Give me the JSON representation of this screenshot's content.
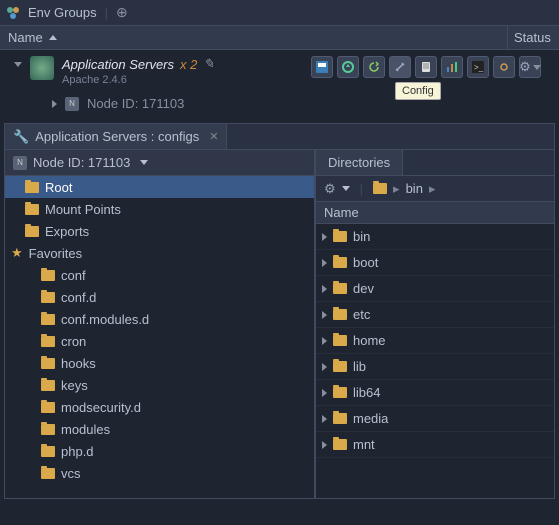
{
  "env_groups_label": "Env Groups",
  "header": {
    "name": "Name",
    "status": "Status"
  },
  "app": {
    "title": "Application Servers",
    "count": "x 2",
    "subtitle": "Apache 2.4.6",
    "node": "Node ID: 171103"
  },
  "tooltip": "Config",
  "panel_tab": "Application Servers : configs",
  "left": {
    "node_header": "Node ID: 171103",
    "root": "Root",
    "mount": "Mount Points",
    "exports": "Exports",
    "favorites": "Favorites",
    "items": [
      "conf",
      "conf.d",
      "conf.modules.d",
      "cron",
      "hooks",
      "keys",
      "modsecurity.d",
      "modules",
      "php.d",
      "vcs"
    ]
  },
  "right": {
    "tab": "Directories",
    "crumb": "bin",
    "name_header": "Name",
    "dirs": [
      "bin",
      "boot",
      "dev",
      "etc",
      "home",
      "lib",
      "lib64",
      "media",
      "mnt"
    ]
  }
}
